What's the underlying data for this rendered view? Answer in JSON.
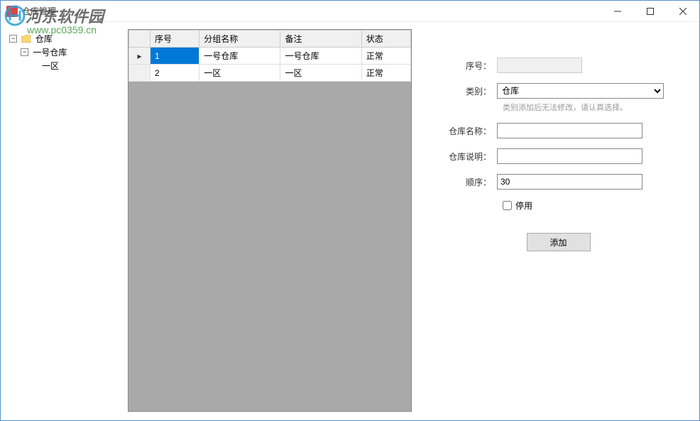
{
  "window": {
    "title": "仓库管理"
  },
  "watermark": {
    "brand": "河东软件园",
    "url": "www.pc0359.cn"
  },
  "tree": {
    "root": "仓库",
    "items": [
      {
        "label": "一号仓库",
        "children": [
          {
            "label": "一区"
          }
        ]
      }
    ]
  },
  "grid": {
    "columns": [
      "序号",
      "分组名称",
      "备注",
      "状态"
    ],
    "rows": [
      {
        "serial": "1",
        "name": "一号仓库",
        "remark": "一号仓库",
        "status": "正常",
        "selected": true
      },
      {
        "serial": "2",
        "name": "一区",
        "remark": "一区",
        "status": "正常",
        "selected": false
      }
    ]
  },
  "form": {
    "labels": {
      "serial": "序号：",
      "category": "类别：",
      "warehouse_name": "仓库名称：",
      "warehouse_desc": "仓库说明：",
      "order": "顺序：",
      "disabled": "停用"
    },
    "values": {
      "serial": "",
      "category": "仓库",
      "warehouse_name": "",
      "warehouse_desc": "",
      "order": "30"
    },
    "hint": "类别添加后无法修改，请认真选择。",
    "submit_label": "添加"
  }
}
